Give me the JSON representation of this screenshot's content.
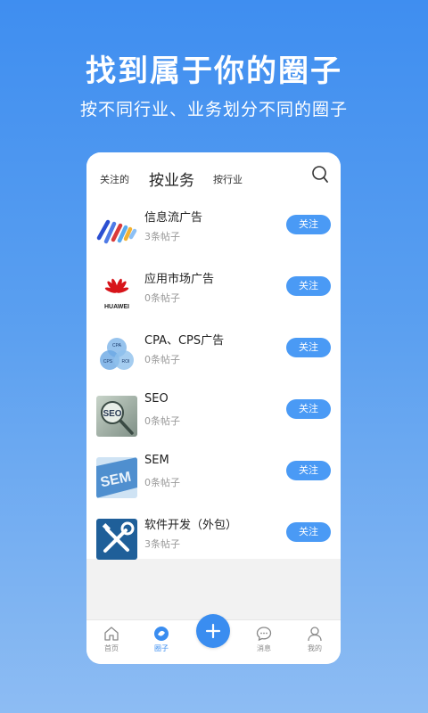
{
  "hero": {
    "title": "找到属于你的圈子",
    "subtitle": "按不同行业、业务划分不同的圈子"
  },
  "topbar": {
    "tabs": [
      "关注的",
      "按业务",
      "按行业"
    ],
    "active_tab": "按业务",
    "search_icon": "search-icon"
  },
  "groups": [
    {
      "title": "信息流广告",
      "count": "3条帖子",
      "follow_label": "关注",
      "icon": "feed-logo"
    },
    {
      "title": "应用市场广告",
      "count": "0条帖子",
      "follow_label": "关注",
      "icon": "huawei-logo",
      "logo_text": "HUAWEI"
    },
    {
      "title": "CPA、CPS广告",
      "count": "0条帖子",
      "follow_label": "关注",
      "icon": "venn-logo",
      "logo_labels": [
        "CPA",
        "CPS",
        "ROI"
      ]
    },
    {
      "title": "SEO",
      "count": "0条帖子",
      "follow_label": "关注",
      "icon": "seo-logo",
      "logo_text": "SEO"
    },
    {
      "title": "SEM",
      "count": "0条帖子",
      "follow_label": "关注",
      "icon": "sem-logo",
      "logo_text": "SEM"
    },
    {
      "title": "软件开发（外包）",
      "count": "3条帖子",
      "follow_label": "关注",
      "icon": "tools-logo"
    }
  ],
  "nav": {
    "items": [
      {
        "label": "首页",
        "icon": "home-icon"
      },
      {
        "label": "圈子",
        "icon": "circle-icon"
      },
      {
        "label": "消息",
        "icon": "message-icon"
      },
      {
        "label": "我的",
        "icon": "user-icon"
      }
    ],
    "active": "圈子",
    "add_icon": "plus-icon",
    "add_label": "+"
  },
  "colors": {
    "accent": "#3a8df0",
    "follow_button": "#4a9af5",
    "background_top": "#3f8ef0",
    "background_bottom": "#8dbcf3"
  }
}
